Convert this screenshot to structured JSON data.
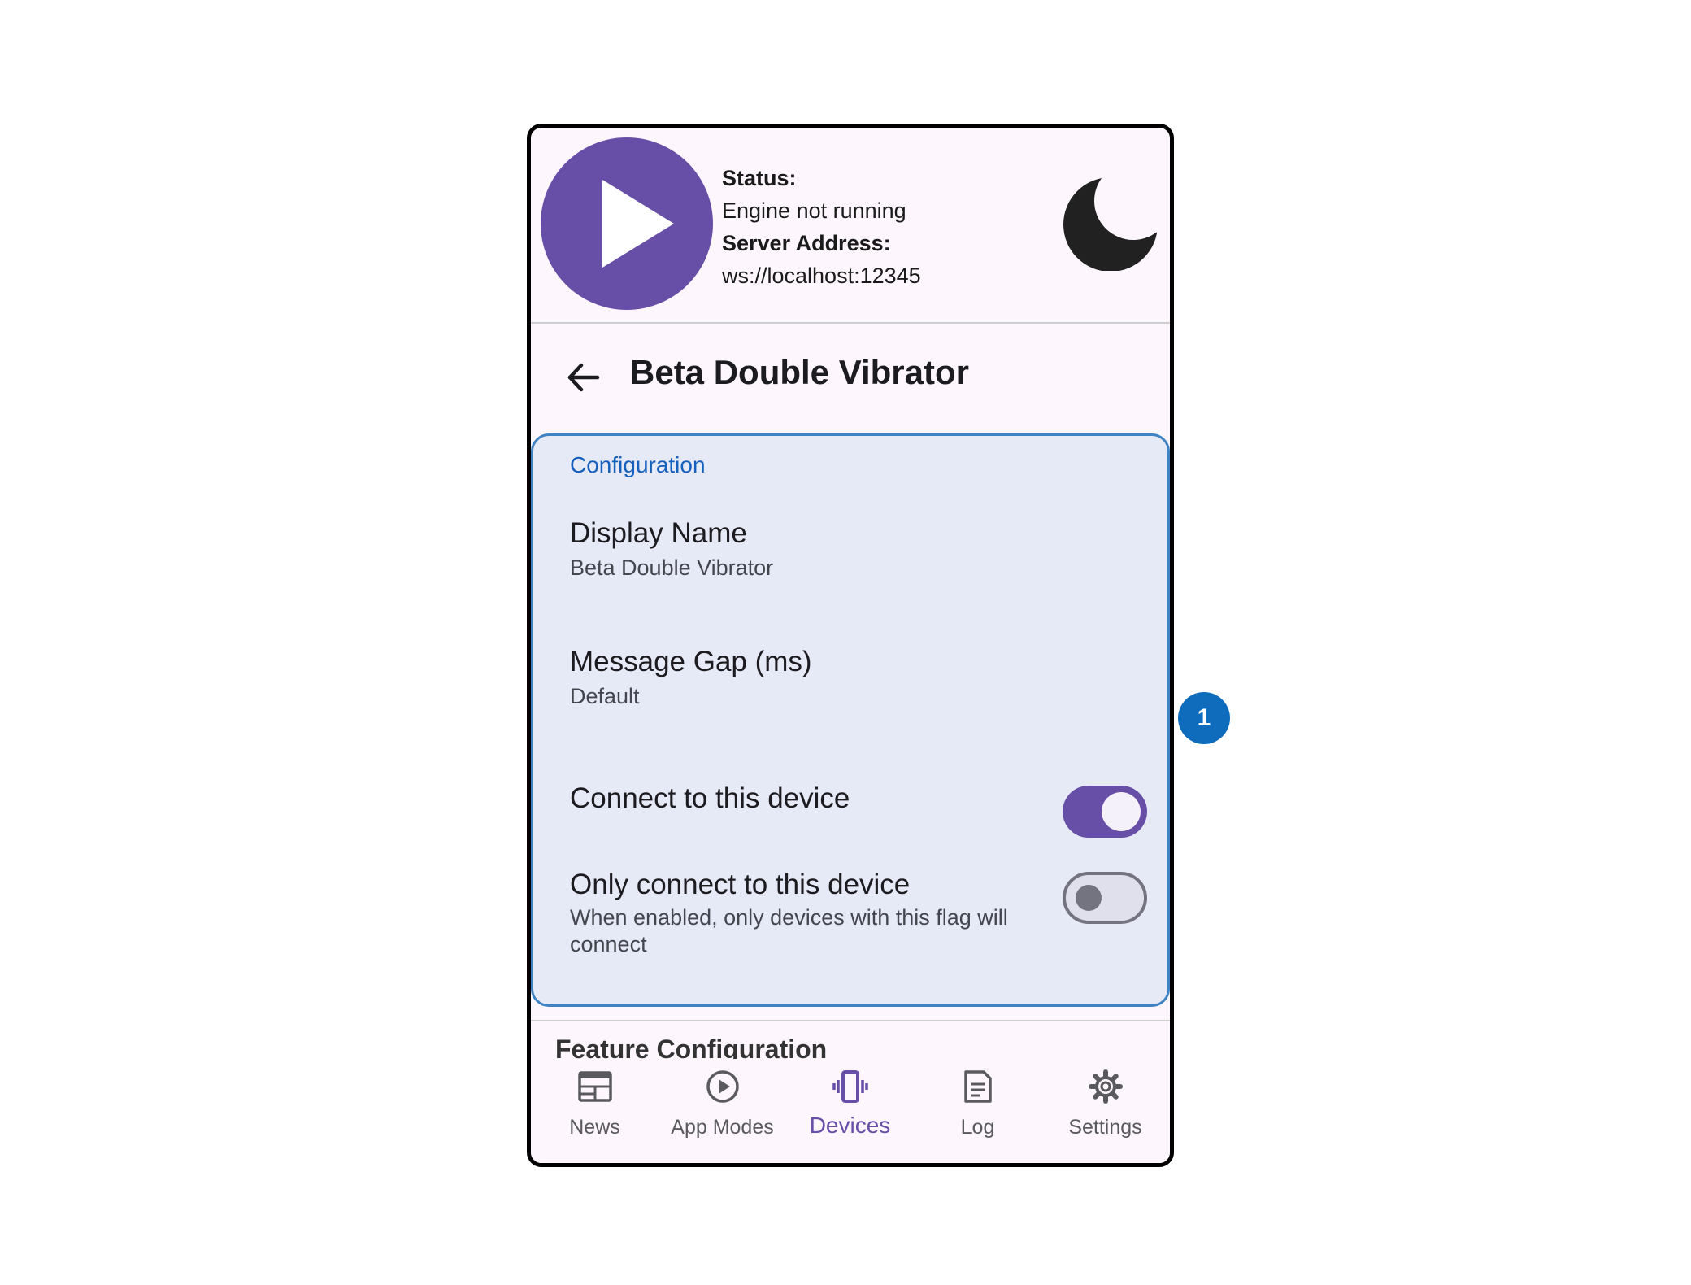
{
  "header": {
    "status_label": "Status:",
    "status_value": "Engine not running",
    "server_label": "Server Address:",
    "server_value": "ws://localhost:12345",
    "play_icon": "play-icon",
    "theme_icon": "moon-icon"
  },
  "title_bar": {
    "title": "Beta Double Vibrator",
    "back_icon": "arrow-back-icon"
  },
  "configuration": {
    "header": "Configuration",
    "display_name": {
      "title": "Display Name",
      "value": "Beta Double Vibrator"
    },
    "message_gap": {
      "title": "Message Gap (ms)",
      "value": "Default"
    },
    "connect_device": {
      "title": "Connect to this device",
      "enabled": true
    },
    "only_connect": {
      "title": "Only connect to this device",
      "subtitle": "When enabled, only devices with this flag will connect",
      "enabled": false
    }
  },
  "feature_configuration": {
    "title": "Feature Configuration"
  },
  "bottom_nav": {
    "items": [
      {
        "label": "News",
        "icon": "news-icon",
        "active": false
      },
      {
        "label": "App Modes",
        "icon": "play-circle-icon",
        "active": false
      },
      {
        "label": "Devices",
        "icon": "vibrate-icon",
        "active": true
      },
      {
        "label": "Log",
        "icon": "document-icon",
        "active": false
      },
      {
        "label": "Settings",
        "icon": "gear-icon",
        "active": false
      }
    ]
  },
  "callout": {
    "number": "1"
  },
  "colors": {
    "primary": "#674ea7",
    "card_bg": "#e6e9f6",
    "card_border": "#3f83c4",
    "config_header": "#1560bd",
    "callout": "#0f6cbd"
  }
}
